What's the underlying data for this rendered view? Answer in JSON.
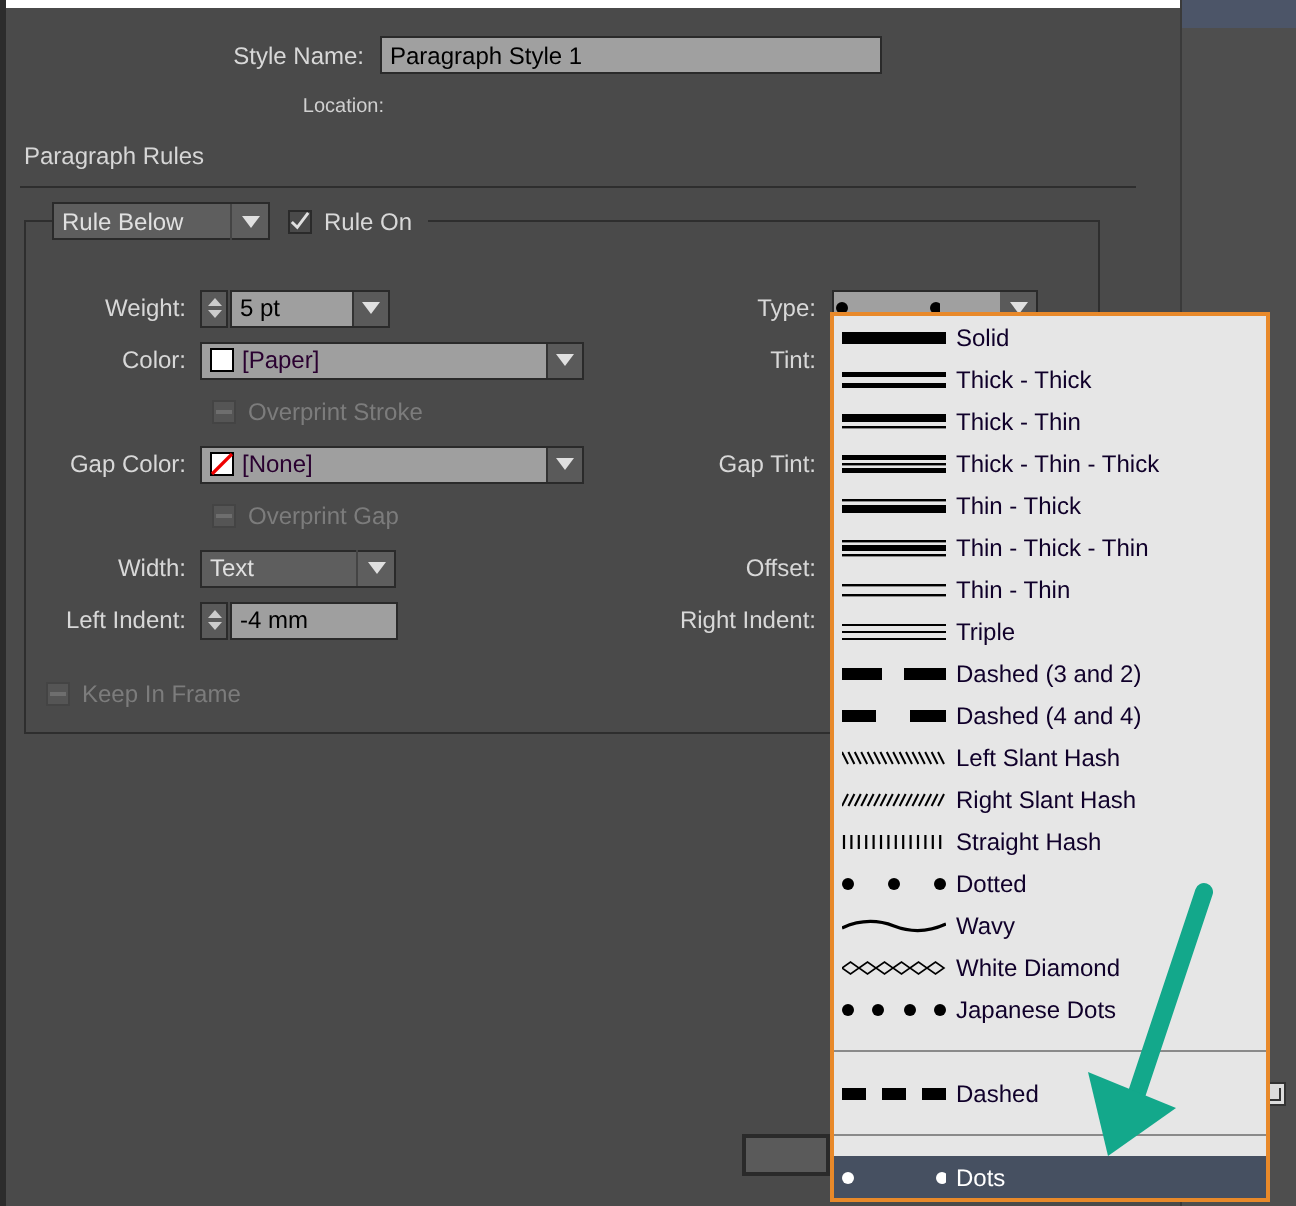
{
  "style_name": {
    "label": "Style Name:",
    "value": "Paragraph Style 1"
  },
  "location": {
    "label": "Location:"
  },
  "section_title": "Paragraph Rules",
  "rule_select": {
    "value": "Rule Below"
  },
  "rule_on": {
    "label": "Rule On",
    "checked": true
  },
  "rows": [
    {
      "kind": "spinner",
      "label": "Weight:",
      "value": "5 pt",
      "dropdown": true,
      "right_label": "Type:"
    },
    {
      "kind": "swatch",
      "label": "Color:",
      "value": "[Paper]",
      "swatch": {
        "kind": "paper"
      },
      "right_label": "Tint:"
    },
    {
      "kind": "checkbox",
      "label": "Overprint Stroke",
      "checked": false,
      "disabled": true
    },
    {
      "kind": "swatch",
      "label": "Gap Color:",
      "value": "[None]",
      "swatch": {
        "kind": "none"
      },
      "right_label": "Gap Tint:"
    },
    {
      "kind": "checkbox",
      "label": "Overprint Gap",
      "checked": false,
      "disabled": true
    },
    {
      "kind": "select",
      "label": "Width:",
      "value": "Text",
      "right_label": "Offset:"
    },
    {
      "kind": "spinner",
      "label": "Left Indent:",
      "value": "-4 mm",
      "dropdown": false,
      "right_label": "Right Indent:"
    }
  ],
  "keep_in_frame": {
    "label": "Keep In Frame",
    "checked": false,
    "disabled": true
  },
  "type_field": {
    "kind": "dots"
  },
  "type_menu": {
    "groups": [
      [
        {
          "kind": "solid",
          "label": "Solid",
          "selected": false
        },
        {
          "kind": "thickthick",
          "label": "Thick - Thick",
          "selected": false
        },
        {
          "kind": "thickthin",
          "label": "Thick - Thin",
          "selected": false
        },
        {
          "kind": "thickthinthick",
          "label": "Thick - Thin - Thick",
          "selected": false
        },
        {
          "kind": "thinthick",
          "label": "Thin - Thick",
          "selected": false
        },
        {
          "kind": "thinthickthin",
          "label": "Thin - Thick - Thin",
          "selected": false
        },
        {
          "kind": "thinthin",
          "label": "Thin - Thin",
          "selected": false
        },
        {
          "kind": "triple",
          "label": "Triple",
          "selected": false
        },
        {
          "kind": "dashed32",
          "label": "Dashed (3 and 2)",
          "selected": false
        },
        {
          "kind": "dashed44",
          "label": "Dashed (4 and 4)",
          "selected": false
        },
        {
          "kind": "leftslant",
          "label": "Left Slant Hash",
          "selected": false
        },
        {
          "kind": "rightslant",
          "label": "Right Slant Hash",
          "selected": false
        },
        {
          "kind": "straighthash",
          "label": "Straight Hash",
          "selected": false
        },
        {
          "kind": "dotted",
          "label": "Dotted",
          "selected": false
        },
        {
          "kind": "wavy",
          "label": "Wavy",
          "selected": false
        },
        {
          "kind": "diamond",
          "label": "White Diamond",
          "selected": false
        },
        {
          "kind": "japanesedots",
          "label": "Japanese Dots",
          "selected": false
        }
      ],
      [
        {
          "kind": "dashed",
          "label": "Dashed",
          "selected": false
        }
      ],
      [
        {
          "kind": "dots",
          "label": "Dots",
          "selected": true
        }
      ]
    ]
  }
}
